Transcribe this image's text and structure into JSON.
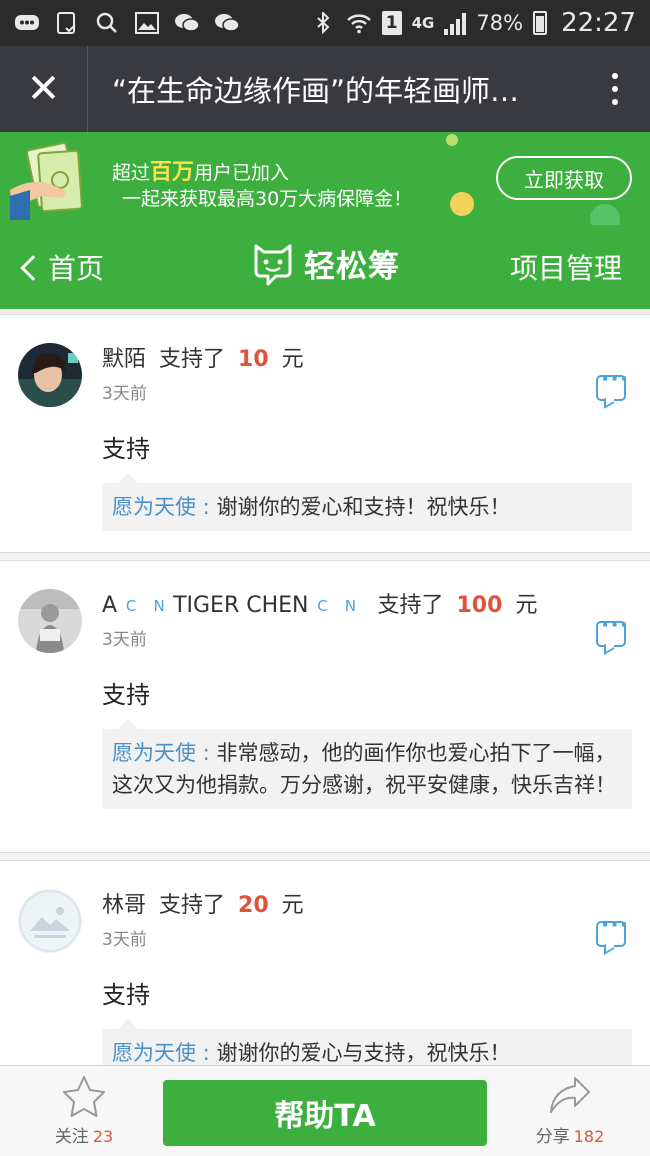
{
  "status_bar": {
    "battery": "78%",
    "time": "22:27",
    "network": "4G",
    "sim": "1",
    "icons": [
      "chat-bubble-icon",
      "clipboard-check-icon",
      "search-icon",
      "image-icon",
      "wechat-icon",
      "wechat-icon",
      "bluetooth-icon",
      "wifi-icon",
      "signal-icon",
      "battery-icon"
    ]
  },
  "title_bar": {
    "title": "“在生命边缘作画”的年轻画师…"
  },
  "banner": {
    "line1_prefix": "超过",
    "line1_highlight": "百万",
    "line1_suffix": "用户已加入",
    "line2": "一起来获取最高30万大病保障金！",
    "button": "立即获取"
  },
  "nav": {
    "back": "首页",
    "logo_text": "轻松筹",
    "manage": "项目管理"
  },
  "comments": [
    {
      "name": "默陌",
      "supported": "支持了",
      "amount": "10",
      "unit": "元",
      "time": "3天前",
      "content": "支持",
      "reply_author": "愿为天使 :",
      "reply_text": "谢谢你的爱心和支持！祝快乐！"
    },
    {
      "name_a": "A",
      "name_mid": "TIGER CHEN",
      "supported": "支持了",
      "amount": "100",
      "unit": "元",
      "time": "3天前",
      "content": "支持",
      "reply_author": "愿为天使 :",
      "reply_text": "非常感动，他的画作你也爱心拍下了一幅，这次又为他捐款。万分感谢，祝平安健康，快乐吉祥！"
    },
    {
      "name": "林哥",
      "supported": "支持了",
      "amount": "20",
      "unit": "元",
      "time": "3天前",
      "content": "支持",
      "reply_author": "愿为天使 :",
      "reply_text": "谢谢你的爱心与支持，祝快乐！"
    }
  ],
  "bottom_bar": {
    "follow_label": "关注",
    "follow_count": "23",
    "help_button": "帮助TA",
    "share_label": "分享",
    "share_count": "182"
  },
  "colors": {
    "brand_green": "#3daf3e",
    "amount_red": "#e0533a",
    "reply_blue": "#4a90c8"
  }
}
